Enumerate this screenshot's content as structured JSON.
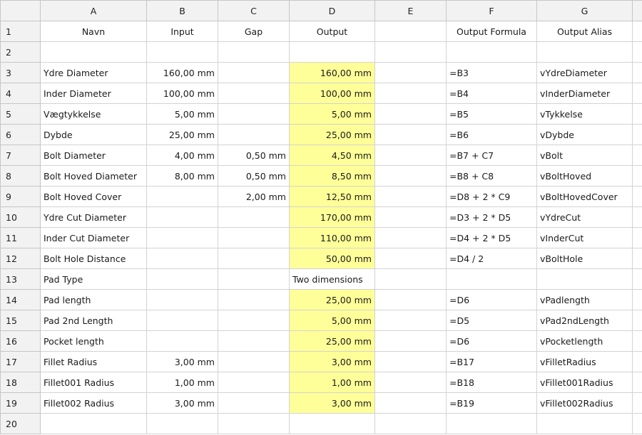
{
  "columns": [
    "A",
    "B",
    "C",
    "D",
    "E",
    "F",
    "G"
  ],
  "highlight_color": "#ffff99",
  "rows": [
    {
      "num": "1",
      "cells": [
        "Navn",
        "Input",
        "Gap",
        "Output",
        "",
        "Output Formula",
        "Output Alias"
      ]
    },
    {
      "num": "2",
      "cells": [
        "",
        "",
        "",
        "",
        "",
        "",
        ""
      ]
    },
    {
      "num": "3",
      "cells": [
        "Ydre Diameter",
        "160,00 mm",
        "",
        "160,00 mm",
        "",
        "=B3",
        "vYdreDiameter"
      ]
    },
    {
      "num": "4",
      "cells": [
        "Inder Diameter",
        "100,00 mm",
        "",
        "100,00 mm",
        "",
        "=B4",
        "vInderDiameter"
      ]
    },
    {
      "num": "5",
      "cells": [
        "Vægtykkelse",
        "5,00 mm",
        "",
        "5,00 mm",
        "",
        "=B5",
        "vTykkelse"
      ]
    },
    {
      "num": "6",
      "cells": [
        "Dybde",
        "25,00 mm",
        "",
        "25,00 mm",
        "",
        "=B6",
        "vDybde"
      ]
    },
    {
      "num": "7",
      "cells": [
        "Bolt Diameter",
        "4,00 mm",
        "0,50 mm",
        "4,50 mm",
        "",
        "=B7 + C7",
        "vBolt"
      ]
    },
    {
      "num": "8",
      "cells": [
        "Bolt Hoved Diameter",
        "8,00 mm",
        "0,50 mm",
        "8,50 mm",
        "",
        "=B8 + C8",
        "vBoltHoved"
      ]
    },
    {
      "num": "9",
      "cells": [
        "Bolt Hoved Cover",
        "",
        "2,00 mm",
        "12,50 mm",
        "",
        "=D8 + 2 * C9",
        "vBoltHovedCover"
      ]
    },
    {
      "num": "10",
      "cells": [
        "Ydre Cut Diameter",
        "",
        "",
        "170,00 mm",
        "",
        "=D3 + 2 * D5",
        "vYdreCut"
      ]
    },
    {
      "num": "11",
      "cells": [
        "Inder Cut Diameter",
        "",
        "",
        "110,00 mm",
        "",
        "=D4 + 2 * D5",
        "vInderCut"
      ]
    },
    {
      "num": "12",
      "cells": [
        "Bolt Hole Distance",
        "",
        "",
        "50,00 mm",
        "",
        "=D4 / 2",
        "vBoltHole"
      ]
    },
    {
      "num": "13",
      "cells": [
        "Pad Type",
        "",
        "",
        "Two dimensions",
        "",
        "",
        ""
      ]
    },
    {
      "num": "14",
      "cells": [
        "Pad length",
        "",
        "",
        "25,00 mm",
        "",
        "=D6",
        "vPadlength"
      ]
    },
    {
      "num": "15",
      "cells": [
        "Pad 2nd Length",
        "",
        "",
        "5,00 mm",
        "",
        "=D5",
        "vPad2ndLength"
      ]
    },
    {
      "num": "16",
      "cells": [
        "Pocket length",
        "",
        "",
        "25,00 mm",
        "",
        "=D6",
        "vPocketlength"
      ]
    },
    {
      "num": "17",
      "cells": [
        "Fillet Radius",
        "3,00 mm",
        "",
        "3,00 mm",
        "",
        "=B17",
        "vFilletRadius"
      ]
    },
    {
      "num": "18",
      "cells": [
        "Fillet001 Radius",
        "1,00 mm",
        "",
        "1,00 mm",
        "",
        "=B18",
        "vFillet001Radius"
      ]
    },
    {
      "num": "19",
      "cells": [
        "Fillet002 Radius",
        "3,00 mm",
        "",
        "3,00 mm",
        "",
        "=B19",
        "vFillet002Radius"
      ]
    },
    {
      "num": "20",
      "cells": [
        "",
        "",
        "",
        "",
        "",
        "",
        ""
      ]
    }
  ]
}
